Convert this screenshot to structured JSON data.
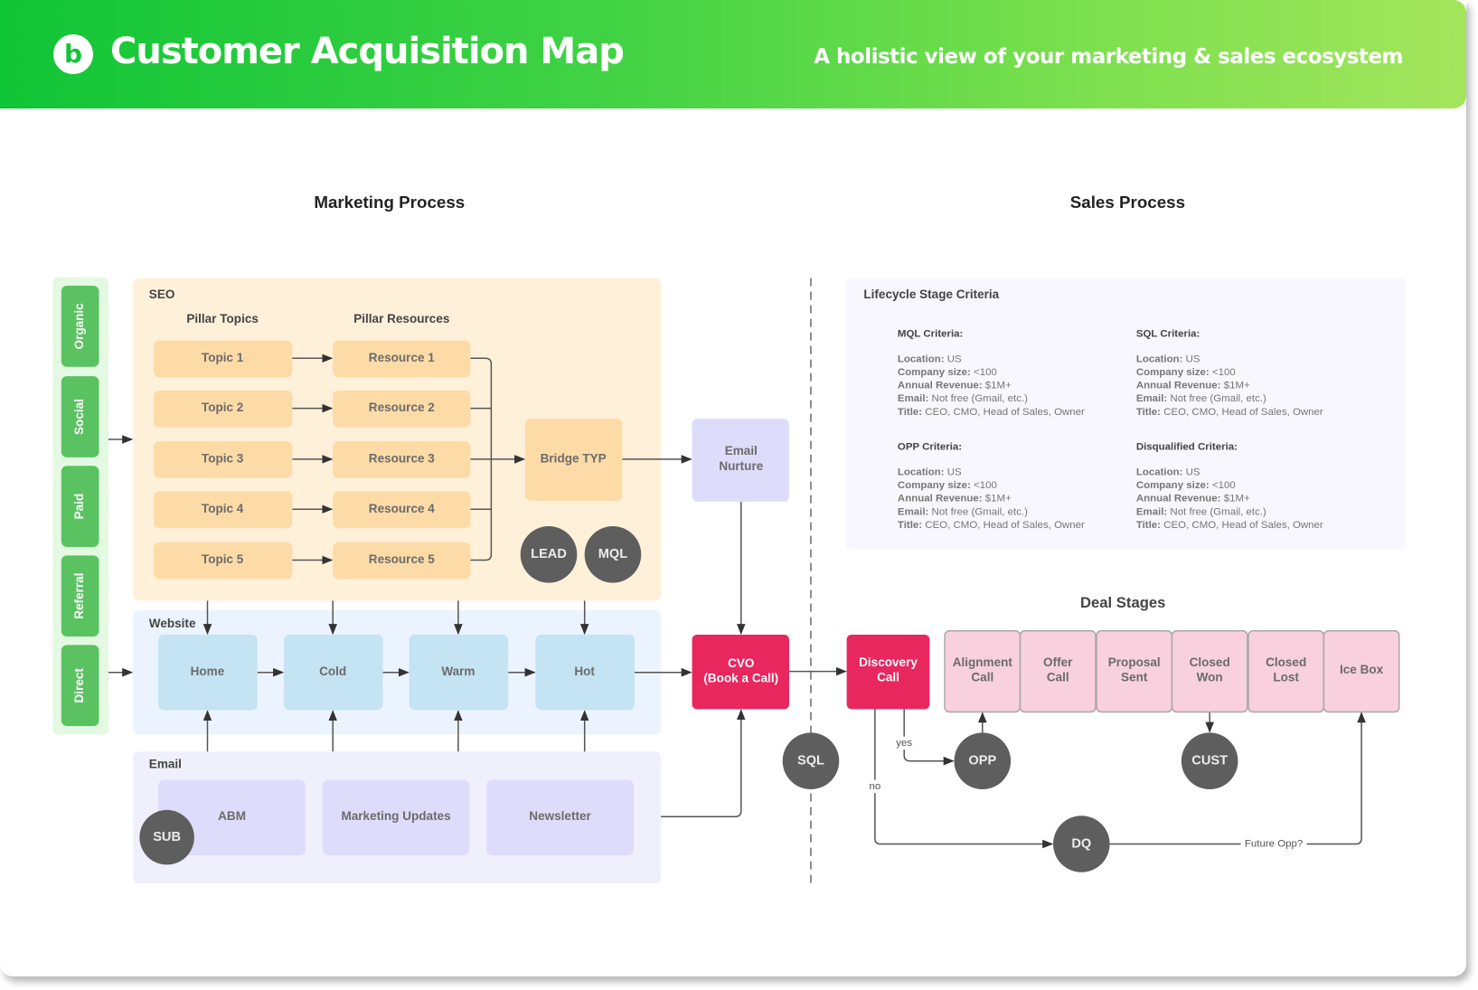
{
  "header": {
    "title": "Customer Acquisition Map",
    "subtitle": "A holistic view of your marketing & sales ecosystem",
    "logo_icon": "b-logo-icon"
  },
  "sections": {
    "marketing": "Marketing Process",
    "sales": "Sales Process"
  },
  "channels": [
    "Organic",
    "Social",
    "Paid",
    "Referral",
    "Direct"
  ],
  "seo": {
    "label": "SEO",
    "topics_header": "Pillar Topics",
    "resources_header": "Pillar Resources",
    "topics": [
      "Topic 1",
      "Topic 2",
      "Topic 3",
      "Topic 4",
      "Topic 5"
    ],
    "resources": [
      "Resource 1",
      "Resource 2",
      "Resource 3",
      "Resource 4",
      "Resource 5"
    ],
    "bridge": "Bridge TYP",
    "badges": [
      "LEAD",
      "MQL"
    ]
  },
  "website": {
    "label": "Website",
    "pages": [
      "Home",
      "Cold",
      "Warm",
      "Hot"
    ]
  },
  "email": {
    "label": "Email",
    "items": [
      "ABM",
      "Marketing Updates",
      "Newsletter"
    ],
    "badge": "SUB"
  },
  "email_nurture": [
    "Email",
    "Nurture"
  ],
  "cvo": [
    "CVO",
    "(Book a Call)"
  ],
  "sql_badge": "SQL",
  "discovery": [
    "Discovery",
    "Call"
  ],
  "lifecycle": {
    "title": "Lifecycle Stage Criteria",
    "blocks": [
      {
        "title": "MQL Criteria:",
        "rows": [
          [
            "Location:",
            "US"
          ],
          [
            "Company size:",
            "<100"
          ],
          [
            "Annual Revenue:",
            "$1M+"
          ],
          [
            "Email:",
            "Not free (Gmail, etc.)"
          ],
          [
            "Title:",
            "CEO, CMO, Head of Sales, Owner"
          ]
        ]
      },
      {
        "title": "SQL Criteria:",
        "rows": [
          [
            "Location:",
            "US"
          ],
          [
            "Company size:",
            "<100"
          ],
          [
            "Annual Revenue:",
            "$1M+"
          ],
          [
            "Email:",
            "Not free (Gmail, etc.)"
          ],
          [
            "Title:",
            "CEO, CMO, Head of Sales, Owner"
          ]
        ]
      },
      {
        "title": "OPP Criteria:",
        "rows": [
          [
            "Location:",
            "US"
          ],
          [
            "Company size:",
            "<100"
          ],
          [
            "Annual Revenue:",
            "$1M+"
          ],
          [
            "Email:",
            "Not free (Gmail, etc.)"
          ],
          [
            "Title:",
            "CEO, CMO, Head of Sales, Owner"
          ]
        ]
      },
      {
        "title": "Disqualified Criteria:",
        "rows": [
          [
            "Location:",
            "US"
          ],
          [
            "Company size:",
            "<100"
          ],
          [
            "Annual Revenue:",
            "$1M+"
          ],
          [
            "Email:",
            "Not free (Gmail, etc.)"
          ],
          [
            "Title:",
            "CEO, CMO, Head of Sales, Owner"
          ]
        ]
      }
    ]
  },
  "deal_stages": {
    "title": "Deal Stages",
    "stages": [
      [
        "Alignment",
        "Call"
      ],
      [
        "Offer",
        "Call"
      ],
      [
        "Proposal",
        "Sent"
      ],
      [
        "Closed",
        "Won"
      ],
      [
        "Closed",
        "Lost"
      ],
      [
        "Ice Box"
      ]
    ]
  },
  "outcome_badges": {
    "opp": "OPP",
    "cust": "CUST",
    "dq": "DQ"
  },
  "edge_labels": {
    "yes": "yes",
    "no": "no",
    "future": "Future Opp?"
  },
  "colors": {
    "header_start": "#10c536",
    "header_end": "#a4e55d",
    "channel_green": "#5bc262",
    "seo_bg": "#fff1d9",
    "seo_box": "#fddba7",
    "website_bg": "#ebf4fe",
    "website_box": "#c4e3f3",
    "email_bg": "#f0f0fd",
    "email_box": "#dddcfb",
    "crimson": "#e8275f",
    "pink_stage": "#f8d0de",
    "badge_dark": "#5e5e5e"
  }
}
